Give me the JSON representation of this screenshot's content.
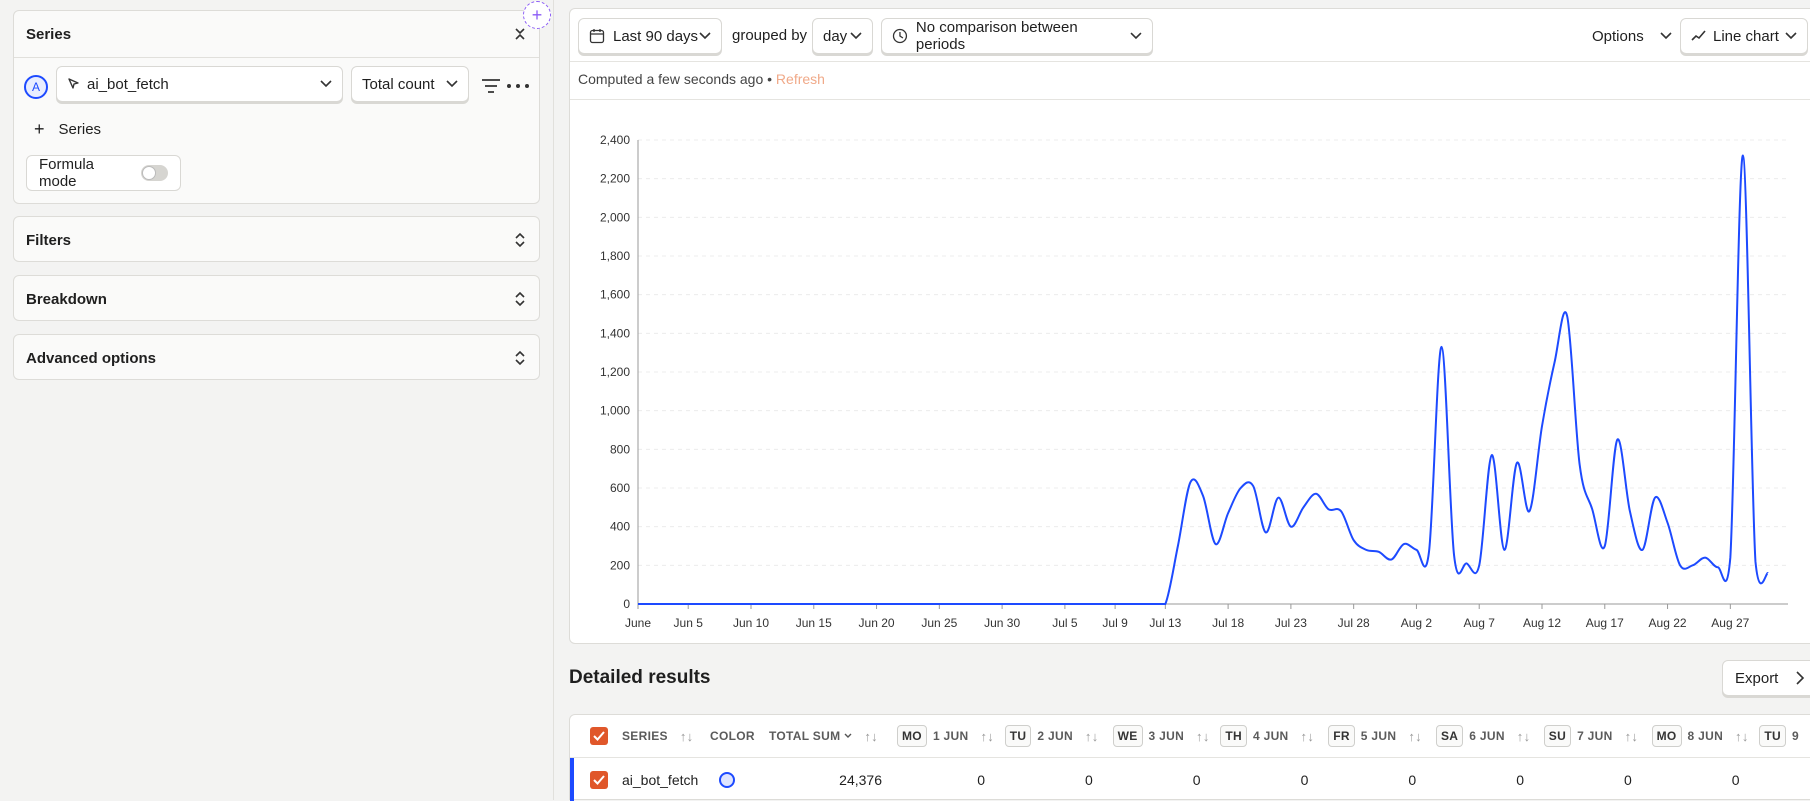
{
  "series_panel": {
    "title": "Series",
    "series_letter": "A",
    "event_name": "ai_bot_fetch",
    "math": "Total count",
    "add_series_label": "Series",
    "formula_mode_label": "Formula mode",
    "formula_mode_on": false
  },
  "sections": {
    "filters": "Filters",
    "breakdown": "Breakdown",
    "advanced": "Advanced options"
  },
  "toolbar": {
    "date_range": "Last 90 days",
    "grouped_by_label": "grouped by",
    "interval": "day",
    "comparison": "No comparison between periods",
    "options_label": "Options",
    "chart_type": "Line chart"
  },
  "status": {
    "computed_text": "Computed a few seconds ago",
    "bullet": "•",
    "refresh_label": "Refresh"
  },
  "colors": {
    "accent": "#e0572a",
    "series_line": "#1d4aff",
    "refresh": "#f0a988"
  },
  "chart_data": {
    "type": "line",
    "ylim": [
      0,
      2400
    ],
    "y_ticks": [
      "0",
      "200",
      "400",
      "600",
      "800",
      "1,000",
      "1,200",
      "1,400",
      "1,600",
      "1,800",
      "2,000",
      "2,200",
      "2,400"
    ],
    "x_tick_labels": [
      {
        "day": 0,
        "label": "June"
      },
      {
        "day": 4,
        "label": "Jun 5"
      },
      {
        "day": 9,
        "label": "Jun 10"
      },
      {
        "day": 14,
        "label": "Jun 15"
      },
      {
        "day": 19,
        "label": "Jun 20"
      },
      {
        "day": 24,
        "label": "Jun 25"
      },
      {
        "day": 29,
        "label": "Jun 30"
      },
      {
        "day": 34,
        "label": "Jul 5"
      },
      {
        "day": 38,
        "label": "Jul 9"
      },
      {
        "day": 42,
        "label": "Jul 13"
      },
      {
        "day": 47,
        "label": "Jul 18"
      },
      {
        "day": 52,
        "label": "Jul 23"
      },
      {
        "day": 57,
        "label": "Jul 28"
      },
      {
        "day": 62,
        "label": "Aug 2"
      },
      {
        "day": 67,
        "label": "Aug 7"
      },
      {
        "day": 72,
        "label": "Aug 12"
      },
      {
        "day": 77,
        "label": "Aug 17"
      },
      {
        "day": 82,
        "label": "Aug 22"
      },
      {
        "day": 87,
        "label": "Aug 27"
      }
    ],
    "series": [
      {
        "name": "ai_bot_fetch",
        "values": [
          0,
          0,
          0,
          0,
          0,
          0,
          0,
          0,
          0,
          0,
          0,
          0,
          0,
          0,
          0,
          0,
          0,
          0,
          0,
          0,
          0,
          0,
          0,
          0,
          0,
          0,
          0,
          0,
          0,
          0,
          0,
          0,
          0,
          0,
          0,
          0,
          0,
          0,
          0,
          0,
          0,
          0,
          0,
          300,
          630,
          560,
          310,
          470,
          600,
          610,
          370,
          550,
          400,
          500,
          570,
          490,
          480,
          330,
          280,
          270,
          230,
          310,
          280,
          270,
          1330,
          250,
          210,
          200,
          770,
          280,
          730,
          480,
          920,
          1250,
          1490,
          720,
          490,
          300,
          850,
          480,
          280,
          550,
          420,
          200,
          200,
          240,
          190,
          240,
          2320,
          220,
          160
        ]
      }
    ]
  },
  "results": {
    "title": "Detailed results",
    "export_label": "Export",
    "headers": {
      "series": "SERIES",
      "color": "COLOR",
      "total_sum": "TOTAL SUM"
    },
    "day_columns": [
      {
        "dow": "MO",
        "date": "1 JUN",
        "value": "0"
      },
      {
        "dow": "TU",
        "date": "2 JUN",
        "value": "0"
      },
      {
        "dow": "WE",
        "date": "3 JUN",
        "value": "0"
      },
      {
        "dow": "TH",
        "date": "4 JUN",
        "value": "0"
      },
      {
        "dow": "FR",
        "date": "5 JUN",
        "value": "0"
      },
      {
        "dow": "SA",
        "date": "6 JUN",
        "value": "0"
      },
      {
        "dow": "SU",
        "date": "7 JUN",
        "value": "0"
      },
      {
        "dow": "MO",
        "date": "8 JUN",
        "value": "0"
      },
      {
        "dow": "TU",
        "date": "9",
        "value": ""
      }
    ],
    "rows": [
      {
        "series": "ai_bot_fetch",
        "total_sum": "24,376"
      }
    ]
  }
}
